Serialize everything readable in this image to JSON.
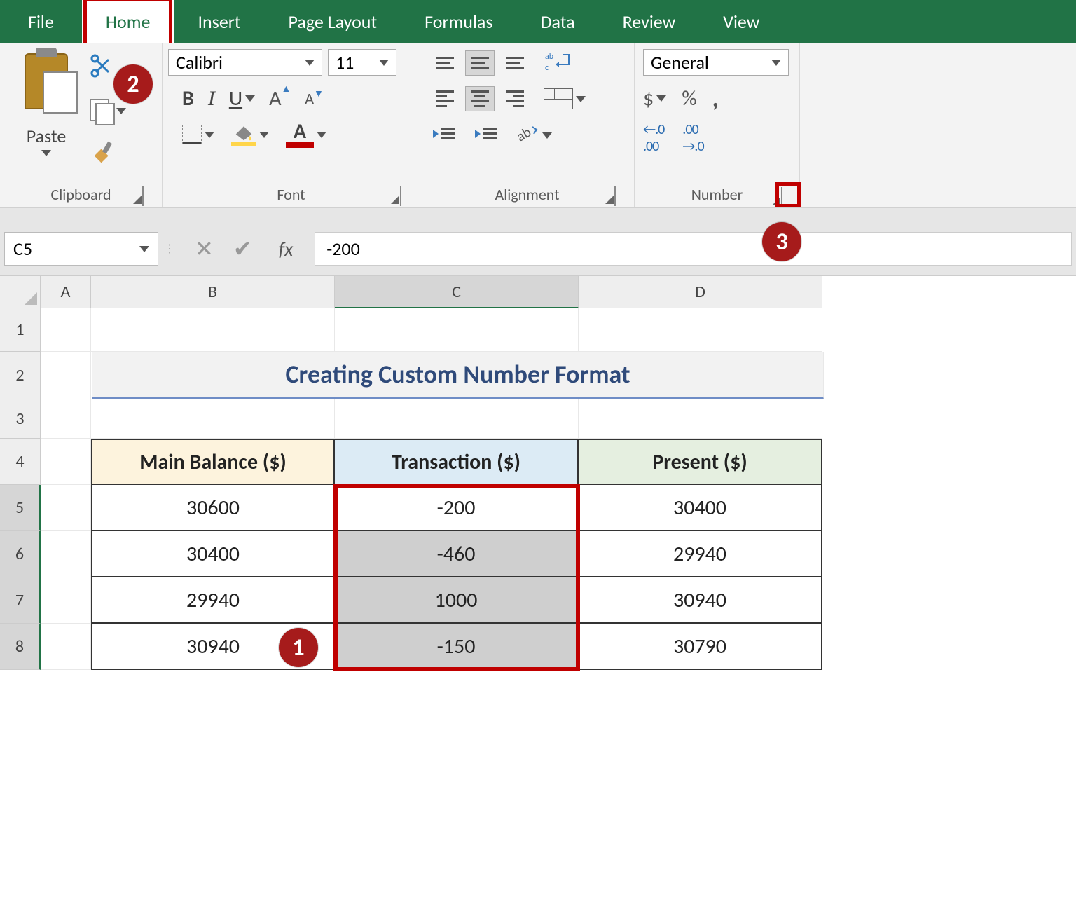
{
  "ribbon": {
    "tabs": [
      "File",
      "Home",
      "Insert",
      "Page Layout",
      "Formulas",
      "Data",
      "Review",
      "View"
    ],
    "activeTab": "Home",
    "groups": {
      "clipboard": {
        "label": "Clipboard",
        "paste": "Paste"
      },
      "font": {
        "label": "Font",
        "fontName": "Calibri",
        "fontSize": "11",
        "bold": "B",
        "italic": "I",
        "underline": "U"
      },
      "alignment": {
        "label": "Alignment"
      },
      "number": {
        "label": "Number",
        "format": "General",
        "currency": "$",
        "percent": "%",
        "comma": ","
      }
    }
  },
  "callouts": {
    "one": "1",
    "two": "2",
    "three": "3"
  },
  "formulaBar": {
    "nameBox": "C5",
    "fxLabel": "fx",
    "value": "-200"
  },
  "columns": [
    "A",
    "B",
    "C",
    "D"
  ],
  "rows": [
    "1",
    "2",
    "3",
    "4",
    "5",
    "6",
    "7",
    "8"
  ],
  "sheet": {
    "title": "Creating Custom Number Format",
    "headers": {
      "B": "Main Balance ($)",
      "C": "Transaction ($)",
      "D": "Present ($)"
    },
    "data": [
      {
        "B": "30600",
        "C": "-200",
        "D": "30400"
      },
      {
        "B": "30400",
        "C": "-460",
        "D": "29940"
      },
      {
        "B": "29940",
        "C": "1000",
        "D": "30940"
      },
      {
        "B": "30940",
        "C": "-150",
        "D": "30790"
      }
    ],
    "selection": {
      "active": "C5",
      "range": "C5:C8"
    }
  }
}
